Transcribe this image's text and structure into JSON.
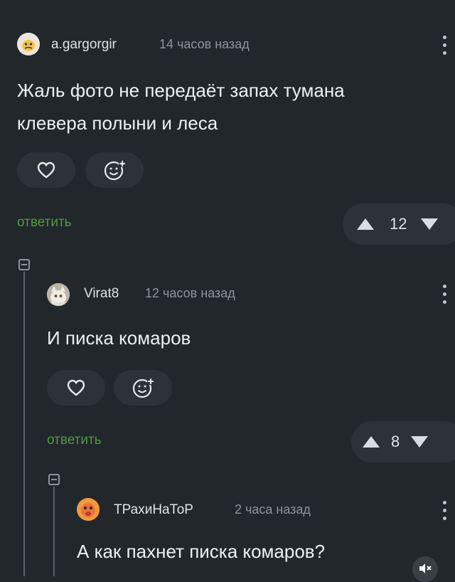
{
  "comments": [
    {
      "username": "a.gargorgir",
      "time": "14 часов назад",
      "text_lines": [
        "Жаль фото не передаёт запах тумана",
        "клевера полыни и леса"
      ],
      "reply_label": "ответить",
      "rating": "12"
    },
    {
      "username": "Virat8",
      "time": "12 часов назад",
      "text_lines": [
        "И писка комаров"
      ],
      "reply_label": "ответить",
      "rating": "8"
    },
    {
      "username": "ТРахиНаТоР",
      "time": "2 часа назад",
      "text_lines": [
        "А как пахнет писка комаров?"
      ]
    }
  ],
  "colors": {
    "background": "#22272c",
    "reply_green": "#4e9a3f",
    "pill": "#2c3238"
  },
  "icons": [
    "heart-icon",
    "add-reaction-icon",
    "upvote-icon",
    "downvote-icon",
    "kebab-menu-icon",
    "collapse-thread-icon",
    "mute-icon"
  ]
}
